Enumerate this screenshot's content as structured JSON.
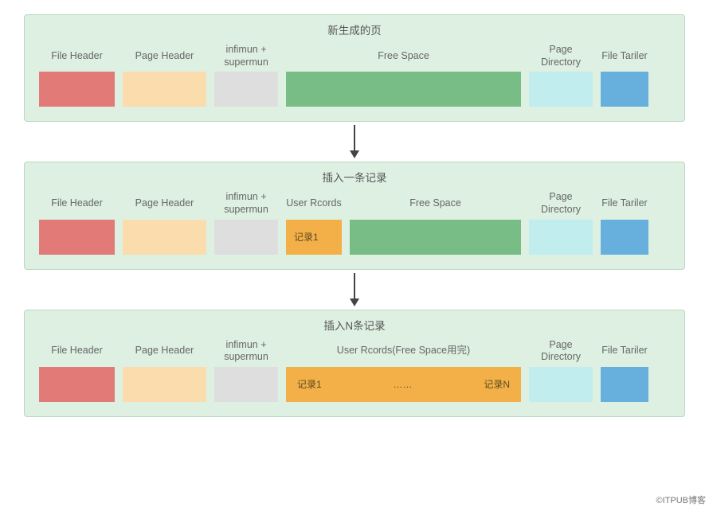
{
  "watermark": "©ITPUB博客",
  "labels": {
    "file_header": "File Header",
    "page_header": "Page Header",
    "infimun": "infimun + supermun",
    "free_space": "Free Space",
    "user_records": "User Rcords",
    "user_records_full": "User Rcords(Free Space用完)",
    "page_directory": "Page Directory",
    "file_trailer": "File Tariler"
  },
  "panels": {
    "new_page": {
      "title": "新生成的页"
    },
    "insert_one": {
      "title": "插入一条记录",
      "record1": "记录1"
    },
    "insert_n": {
      "title": "插入N条记录",
      "record1": "记录1",
      "ellipsis": "……",
      "recordN": "记录N"
    }
  }
}
